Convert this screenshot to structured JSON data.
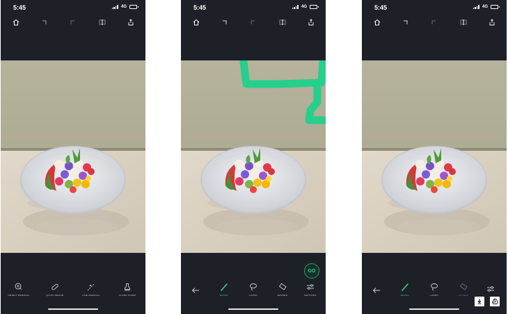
{
  "status_bar": {
    "time": "5:45",
    "network": "4G"
  },
  "screens": [
    {
      "bottom_tools": [
        "OBJECT REMOVAL",
        "QUICK REPAIR",
        "LINE REMOVAL",
        "CLONE STAMP"
      ]
    },
    {
      "bottom_tools": [
        "BRUSH",
        "LASSO",
        "ERASER",
        "SETTINGS"
      ],
      "go_button": "GO"
    },
    {
      "bottom_tools": [
        "BRUSH",
        "LASSO",
        "ERASER"
      ]
    }
  ],
  "colors": {
    "accent": "#3ecf8e",
    "dark_bg": "#1d2127",
    "brush_stroke": "#1fd18a"
  }
}
